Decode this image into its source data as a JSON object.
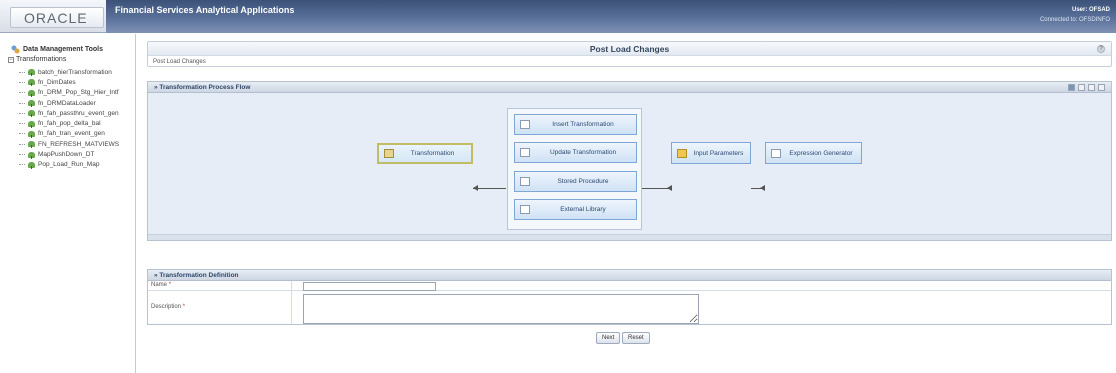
{
  "header": {
    "logo": "ORACLE",
    "app_title": "Financial Services Analytical Applications",
    "user_label": "User: OFSAD",
    "connected_label": "Connected to: OFSDINFO"
  },
  "sidebar": {
    "root_label": "Data Management Tools",
    "folder_label": "Transformations",
    "items": [
      {
        "label": "batch_hierTransformation"
      },
      {
        "label": "fn_DimDates"
      },
      {
        "label": "fn_DRM_Pop_Stg_Hier_Intf"
      },
      {
        "label": "fn_DRMDataLoader"
      },
      {
        "label": "fn_fah_passthru_event_gen"
      },
      {
        "label": "fn_fah_pop_delta_bal"
      },
      {
        "label": "fn_fah_tran_event_gen"
      },
      {
        "label": "FN_REFRESH_MATVIEWS"
      },
      {
        "label": "MapPushDown_DT"
      },
      {
        "label": "Pop_Load_Run_Map"
      }
    ]
  },
  "page": {
    "title": "Post Load Changes",
    "breadcrumb": "Post Load Changes"
  },
  "flow": {
    "title": "» Transformation Process Flow",
    "transformation": "Transformation",
    "insert": "Insert Transformation",
    "update": "Update Transformation",
    "stored": "Stored Procedure",
    "external": "External Library",
    "input_params": "Input Parameters",
    "expr_gen": "Expression Generator"
  },
  "definition": {
    "title": "» Transformation Definition",
    "name_label": "Name",
    "desc_label": "Description",
    "required_mark": "*",
    "name_value": "",
    "desc_value": ""
  },
  "buttons": {
    "next": "Next",
    "reset": "Reset"
  },
  "colors": {
    "brand_band": "#3b5178",
    "flow_background": "#e7edf6",
    "node_border": "#7fa7d4",
    "selected_node_border": "#c2bc64"
  }
}
